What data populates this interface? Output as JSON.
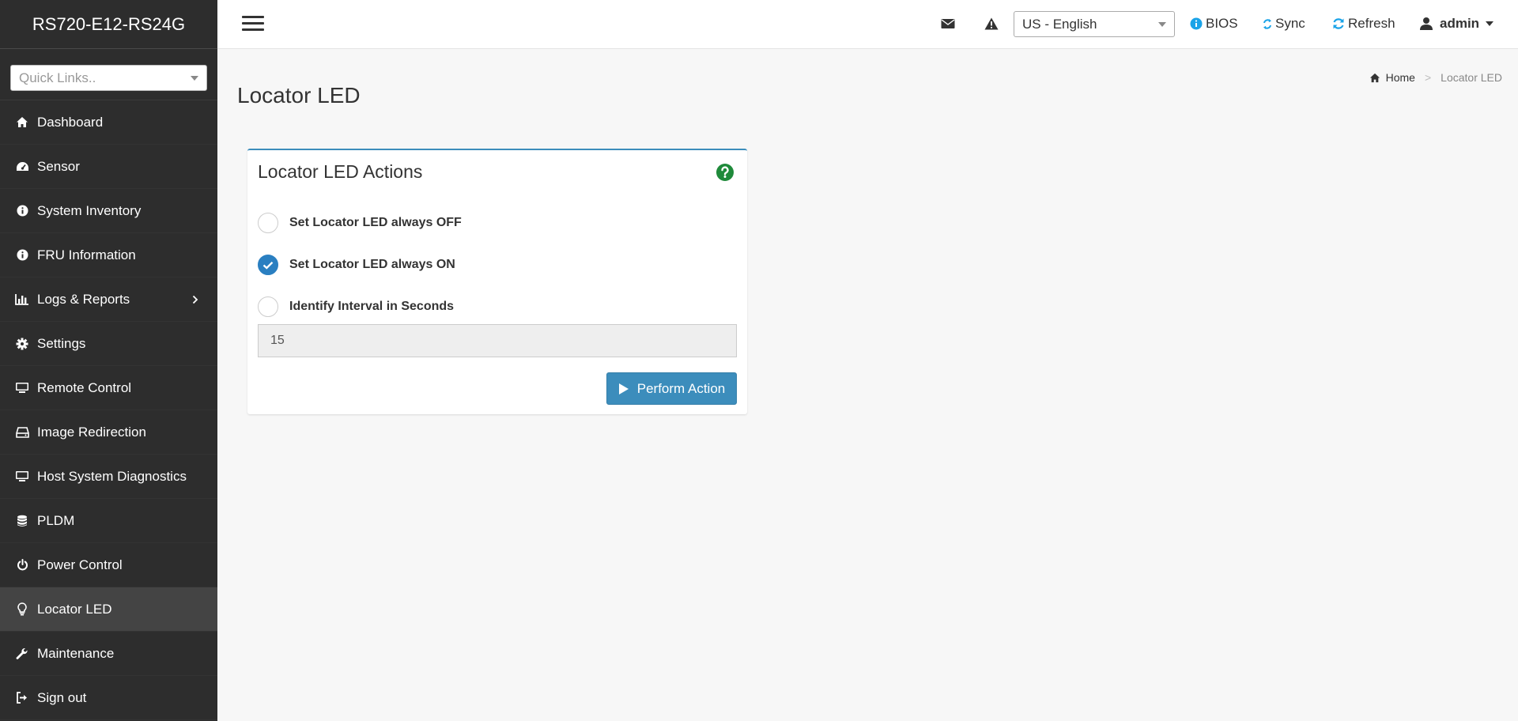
{
  "app": {
    "title": "RS720-E12-RS24G"
  },
  "sidebar": {
    "quick_links_placeholder": "Quick Links..",
    "items": [
      {
        "label": "Dashboard",
        "icon": "home-icon"
      },
      {
        "label": "Sensor",
        "icon": "dashboard-gauge-icon"
      },
      {
        "label": "System Inventory",
        "icon": "info-icon"
      },
      {
        "label": "FRU Information",
        "icon": "info-icon"
      },
      {
        "label": "Logs & Reports",
        "icon": "bar-chart-icon"
      },
      {
        "label": "Settings",
        "icon": "gear-icon"
      },
      {
        "label": "Remote Control",
        "icon": "monitor-icon"
      },
      {
        "label": "Image Redirection",
        "icon": "drive-icon"
      },
      {
        "label": "Host System Diagnostics",
        "icon": "monitor-icon"
      },
      {
        "label": "PLDM",
        "icon": "database-icon"
      },
      {
        "label": "Power Control",
        "icon": "power-icon"
      },
      {
        "label": "Locator LED",
        "icon": "lightbulb-icon"
      },
      {
        "label": "Maintenance",
        "icon": "wrench-icon"
      },
      {
        "label": "Sign out",
        "icon": "sign-out-icon"
      }
    ],
    "active_item": "Locator LED"
  },
  "topbar": {
    "language": "US - English",
    "bios_label": "BIOS",
    "sync_label": "Sync",
    "refresh_label": "Refresh",
    "user_label": "admin"
  },
  "page": {
    "title": "Locator LED",
    "breadcrumb": {
      "home": "Home",
      "current": "Locator LED"
    }
  },
  "panel": {
    "title": "Locator LED Actions",
    "options": [
      {
        "label": "Set Locator LED always OFF",
        "checked": false
      },
      {
        "label": "Set Locator LED always ON",
        "checked": true
      },
      {
        "label": "Identify Interval in Seconds",
        "checked": false
      }
    ],
    "interval_value": "15",
    "perform_label": "Perform Action"
  },
  "colors": {
    "sidebar_bg": "#2d2d2d",
    "accent": "#3c8dbc",
    "radio_checked": "#2a7fc1",
    "help_green": "#1f8a3a",
    "info_blue": "#1aa3e8"
  }
}
